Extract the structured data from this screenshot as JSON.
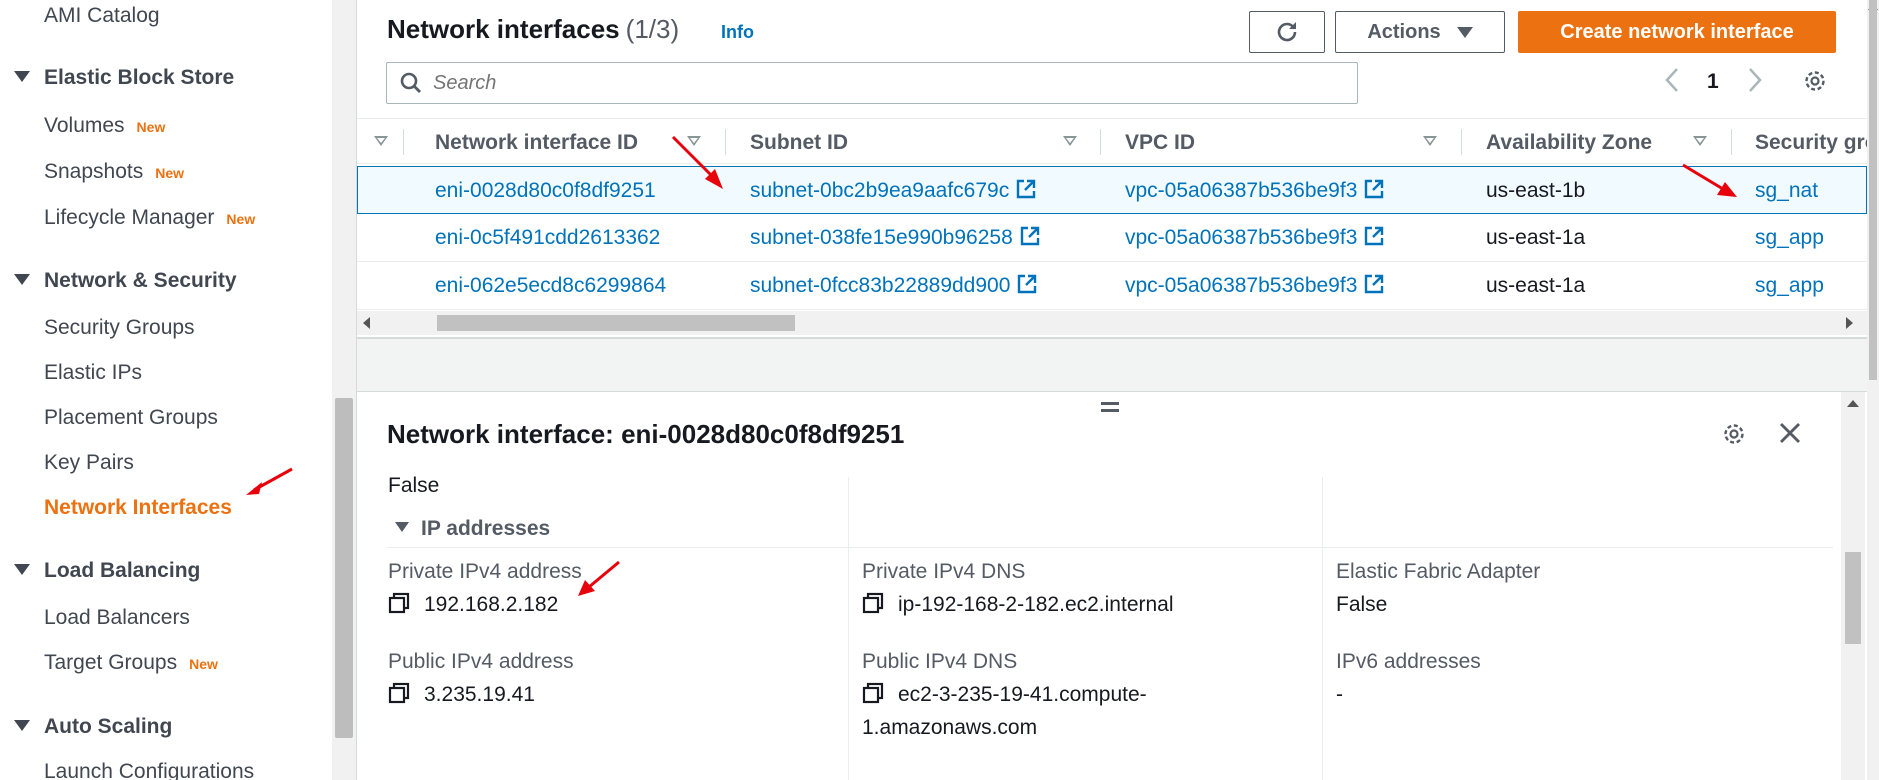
{
  "sidebar": {
    "items": [
      {
        "label": "AMI Catalog"
      },
      {
        "label": "Volumes",
        "badge": "New"
      },
      {
        "label": "Snapshots",
        "badge": "New"
      },
      {
        "label": "Lifecycle Manager",
        "badge": "New"
      },
      {
        "label": "Security Groups"
      },
      {
        "label": "Elastic IPs"
      },
      {
        "label": "Placement Groups"
      },
      {
        "label": "Key Pairs"
      },
      {
        "label": "Network Interfaces"
      },
      {
        "label": "Load Balancers"
      },
      {
        "label": "Target Groups",
        "badge": "New"
      },
      {
        "label": "Launch Configurations"
      }
    ],
    "sections": [
      {
        "label": "Elastic Block Store"
      },
      {
        "label": "Network & Security"
      },
      {
        "label": "Load Balancing"
      },
      {
        "label": "Auto Scaling"
      }
    ]
  },
  "header": {
    "title": "Network interfaces",
    "count": "(1/3)",
    "info": "Info",
    "actions_label": "Actions",
    "create_label": "Create network interface"
  },
  "search": {
    "placeholder": "Search"
  },
  "pagination": {
    "page": "1"
  },
  "table": {
    "columns": [
      "Network interface ID",
      "Subnet ID",
      "VPC ID",
      "Availability Zone",
      "Security gro"
    ],
    "rows": [
      {
        "eni": "eni-0028d80c0f8df9251",
        "subnet": "subnet-0bc2b9ea9aafc679c",
        "vpc": "vpc-05a06387b536be9f3",
        "az": "us-east-1b",
        "sg": "sg_nat"
      },
      {
        "eni": "eni-0c5f491cdd2613362",
        "subnet": "subnet-038fe15e990b96258",
        "vpc": "vpc-05a06387b536be9f3",
        "az": "us-east-1a",
        "sg": "sg_app"
      },
      {
        "eni": "eni-062e5ecd8c6299864",
        "subnet": "subnet-0fcc83b22889dd900",
        "vpc": "vpc-05a06387b536be9f3",
        "az": "us-east-1a",
        "sg": "sg_app"
      }
    ]
  },
  "detail": {
    "title": "Network interface: eni-0028d80c0f8df9251",
    "top_value": "False",
    "ip_section": "IP addresses",
    "private_ipv4_label": "Private IPv4 address",
    "private_ipv4_value": "192.168.2.182",
    "private_dns_label": "Private IPv4 DNS",
    "private_dns_value": "ip-192-168-2-182.ec2.internal",
    "efa_label": "Elastic Fabric Adapter",
    "efa_value": "False",
    "public_ipv4_label": "Public IPv4 address",
    "public_ipv4_value": "3.235.19.41",
    "public_dns_label": "Public IPv4 DNS",
    "public_dns_value_1": "ec2-3-235-19-41.compute-",
    "public_dns_value_2": "1.amazonaws.com",
    "ipv6_label": "IPv6 addresses",
    "ipv6_value": "-"
  },
  "colors": {
    "accent": "#ec7211",
    "link": "#0073bb",
    "annotation": "#e8000b"
  }
}
